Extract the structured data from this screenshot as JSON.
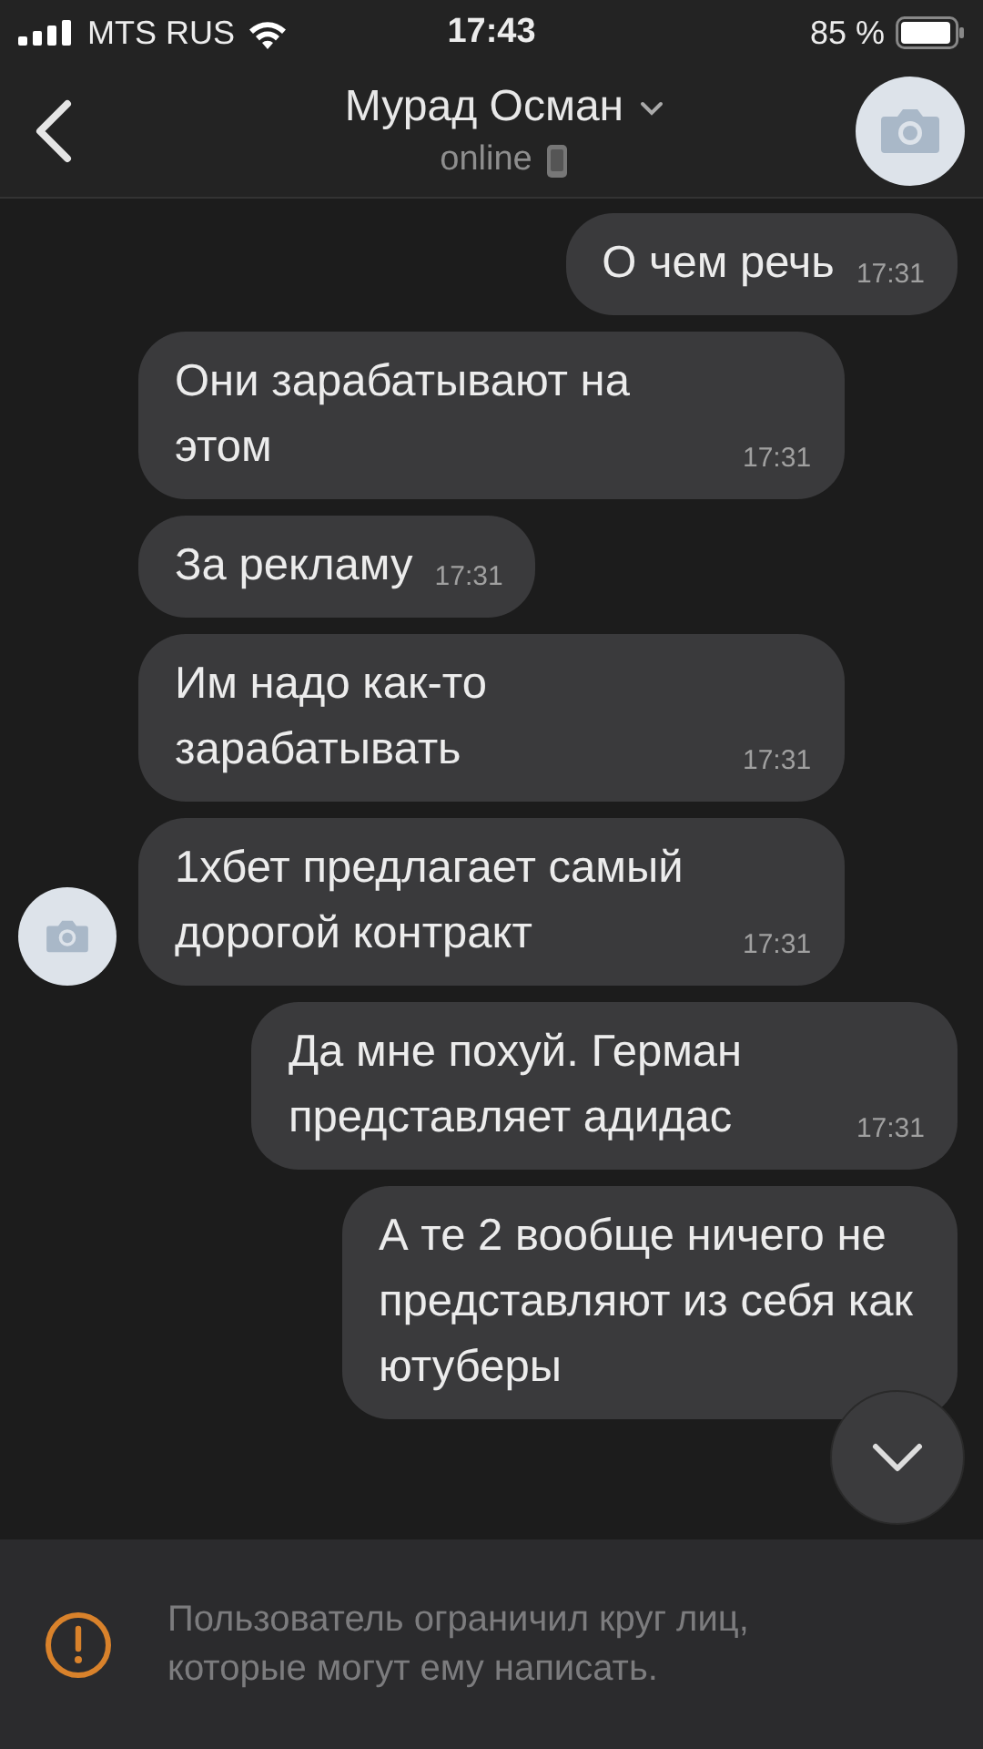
{
  "status_bar": {
    "carrier": "MTS RUS",
    "time": "17:43",
    "battery": "85 %"
  },
  "header": {
    "name": "Мурад Осман",
    "status": "online"
  },
  "messages": [
    {
      "kind": "out",
      "text": "О чем речь",
      "time": "17:31",
      "avatar": false
    },
    {
      "kind": "in",
      "text": "Они зарабатывают на этом",
      "time": "17:31",
      "avatar": false
    },
    {
      "kind": "in",
      "text": "За рекламу",
      "time": "17:31",
      "avatar": false
    },
    {
      "kind": "in",
      "text": "Им надо как-то зарабатывать",
      "time": "17:31",
      "avatar": false
    },
    {
      "kind": "in",
      "text": "1хбет предлагает самый дорогой контракт",
      "time": "17:31",
      "avatar": true
    },
    {
      "kind": "out",
      "text": "Да мне похуй. Герман представляет адидас",
      "time": "17:31",
      "avatar": false
    },
    {
      "kind": "out",
      "text": "А те 2 вообще ничего не представляют из себя как ютуберы",
      "avatar": false
    }
  ],
  "notice": {
    "text": "Пользователь ограничил круг лиц, которые могут ему написать."
  }
}
